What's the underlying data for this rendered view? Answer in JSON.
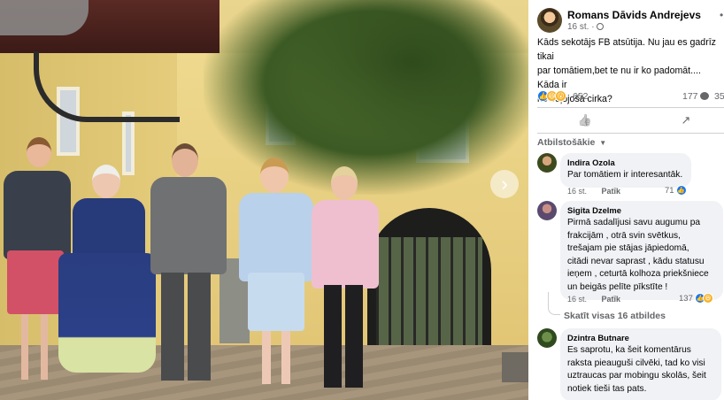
{
  "photo": {
    "next_icon": "chevron-right-icon",
    "next_glyph": "›"
  },
  "post": {
    "author": "Romans Dāvids Andrejevs",
    "time": "16 st.",
    "audience_icon": "globe-icon",
    "audience_glyph": "·",
    "more_glyph": "•",
    "text": "Kāds sekotājs FB atsūtija. Nu jau es gadrīz tikai\npar tomātiem,bet te nu ir ko padomāt.... Kāda ir\nno ceļojošā cirka?",
    "reaction_icons": [
      {
        "name": "like-reaction-icon",
        "glyph": "👍"
      },
      {
        "name": "haha-reaction-icon",
        "glyph": "😆"
      },
      {
        "name": "wow-reaction-icon",
        "glyph": "😮"
      }
    ],
    "reaction_count": "652",
    "comment_count": "177",
    "share_count": "35",
    "like_glyph": "👍",
    "share_glyph": "↗",
    "sort_label": "Atbilstošākie",
    "sort_caret": "▼"
  },
  "comments": [
    {
      "name": "Indira Ozola",
      "text": "Par tomātiem ir interesantāk.",
      "time": "16 st.",
      "like_label": "Patīk",
      "reaction_count": "71"
    },
    {
      "name": "Sigita Dzelme",
      "text": "Pirmā sadalījusi savu augumu pa\nfrakcijām , otrā svin svētkus,\ntrešajam pie stājas jāpiedomā,\ncitādi nevar saprast , kādu statusu\nieņem , ceturtā kolhoza priekšniece\nun beigās pelīte pīkstīte !",
      "time": "16 st.",
      "like_label": "Patīk",
      "reaction_count": "137"
    },
    {
      "name": "Dzintra Butnare",
      "text": "Es saprotu, ka šeit komentārus\nraksta pieauguši cilvēki, tad ko visi\nuztraucas par mobingu skolās, šeit\nnotiek tieši tas pats."
    }
  ],
  "view_replies": "Skatīt visas 16 atbildes"
}
